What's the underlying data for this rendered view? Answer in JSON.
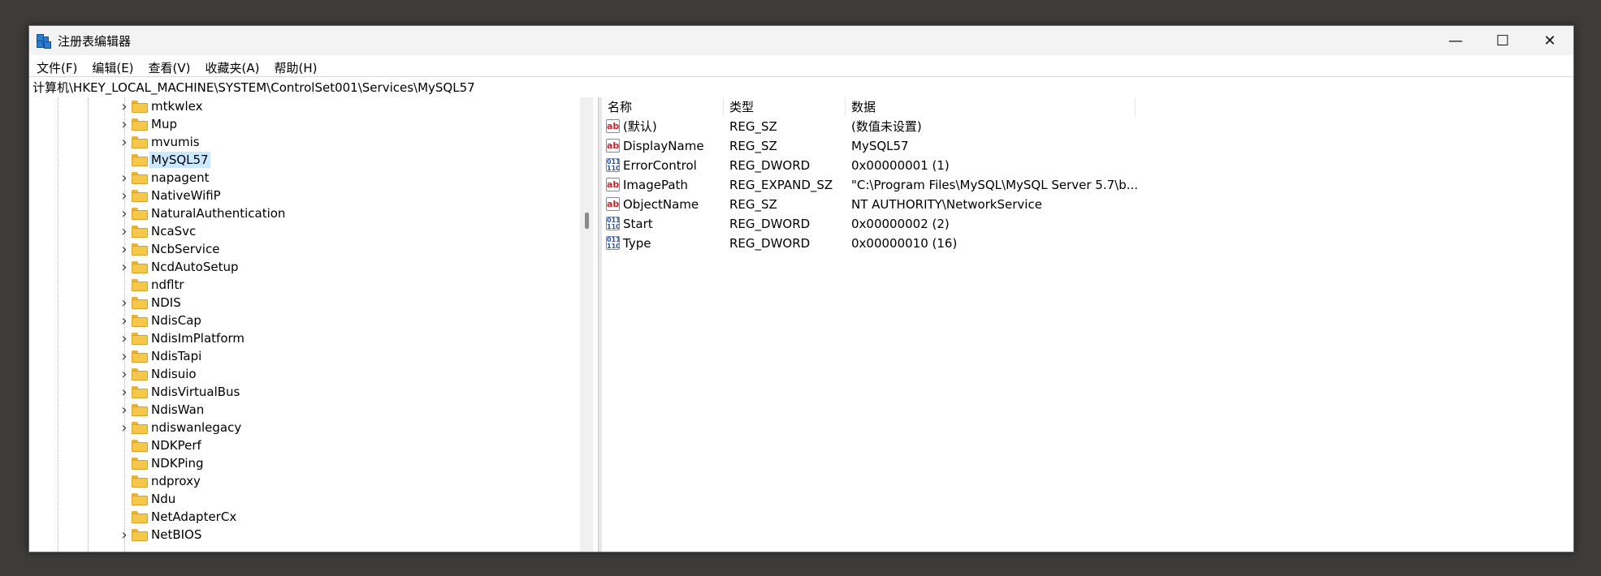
{
  "window": {
    "title": "注册表编辑器",
    "controls": {
      "minimize": "—",
      "maximize": "☐",
      "close": "✕"
    }
  },
  "menu": [
    "文件(F)",
    "编辑(E)",
    "查看(V)",
    "收藏夹(A)",
    "帮助(H)"
  ],
  "address": "计算机\\HKEY_LOCAL_MACHINE\\SYSTEM\\ControlSet001\\Services\\MySQL57",
  "tree": {
    "items": [
      {
        "label": "mtkwlex",
        "expandable": true,
        "selected": false
      },
      {
        "label": "Mup",
        "expandable": true,
        "selected": false
      },
      {
        "label": "mvumis",
        "expandable": true,
        "selected": false
      },
      {
        "label": "MySQL57",
        "expandable": false,
        "selected": true
      },
      {
        "label": "napagent",
        "expandable": true,
        "selected": false
      },
      {
        "label": "NativeWifiP",
        "expandable": true,
        "selected": false
      },
      {
        "label": "NaturalAuthentication",
        "expandable": true,
        "selected": false
      },
      {
        "label": "NcaSvc",
        "expandable": true,
        "selected": false
      },
      {
        "label": "NcbService",
        "expandable": true,
        "selected": false
      },
      {
        "label": "NcdAutoSetup",
        "expandable": true,
        "selected": false
      },
      {
        "label": "ndfltr",
        "expandable": false,
        "selected": false
      },
      {
        "label": "NDIS",
        "expandable": true,
        "selected": false
      },
      {
        "label": "NdisCap",
        "expandable": true,
        "selected": false
      },
      {
        "label": "NdisImPlatform",
        "expandable": true,
        "selected": false
      },
      {
        "label": "NdisTapi",
        "expandable": true,
        "selected": false
      },
      {
        "label": "Ndisuio",
        "expandable": true,
        "selected": false
      },
      {
        "label": "NdisVirtualBus",
        "expandable": true,
        "selected": false
      },
      {
        "label": "NdisWan",
        "expandable": true,
        "selected": false
      },
      {
        "label": "ndiswanlegacy",
        "expandable": true,
        "selected": false
      },
      {
        "label": "NDKPerf",
        "expandable": false,
        "selected": false
      },
      {
        "label": "NDKPing",
        "expandable": false,
        "selected": false
      },
      {
        "label": "ndproxy",
        "expandable": false,
        "selected": false
      },
      {
        "label": "Ndu",
        "expandable": false,
        "selected": false
      },
      {
        "label": "NetAdapterCx",
        "expandable": false,
        "selected": false
      },
      {
        "label": "NetBIOS",
        "expandable": true,
        "selected": false
      }
    ]
  },
  "list": {
    "columns": [
      "名称",
      "类型",
      "数据"
    ],
    "rows": [
      {
        "icon": "ab",
        "name": "(默认)",
        "type": "REG_SZ",
        "data": "(数值未设置)"
      },
      {
        "icon": "ab",
        "name": "DisplayName",
        "type": "REG_SZ",
        "data": "MySQL57"
      },
      {
        "icon": "bin",
        "name": "ErrorControl",
        "type": "REG_DWORD",
        "data": "0x00000001 (1)"
      },
      {
        "icon": "ab",
        "name": "ImagePath",
        "type": "REG_EXPAND_SZ",
        "data": "\"C:\\Program Files\\MySQL\\MySQL Server 5.7\\b..."
      },
      {
        "icon": "ab",
        "name": "ObjectName",
        "type": "REG_SZ",
        "data": "NT AUTHORITY\\NetworkService"
      },
      {
        "icon": "bin",
        "name": "Start",
        "type": "REG_DWORD",
        "data": "0x00000002 (2)"
      },
      {
        "icon": "bin",
        "name": "Type",
        "type": "REG_DWORD",
        "data": "0x00000010 (16)"
      }
    ]
  },
  "icons": {
    "string_value": "ab",
    "binary_value": "011\n110"
  }
}
